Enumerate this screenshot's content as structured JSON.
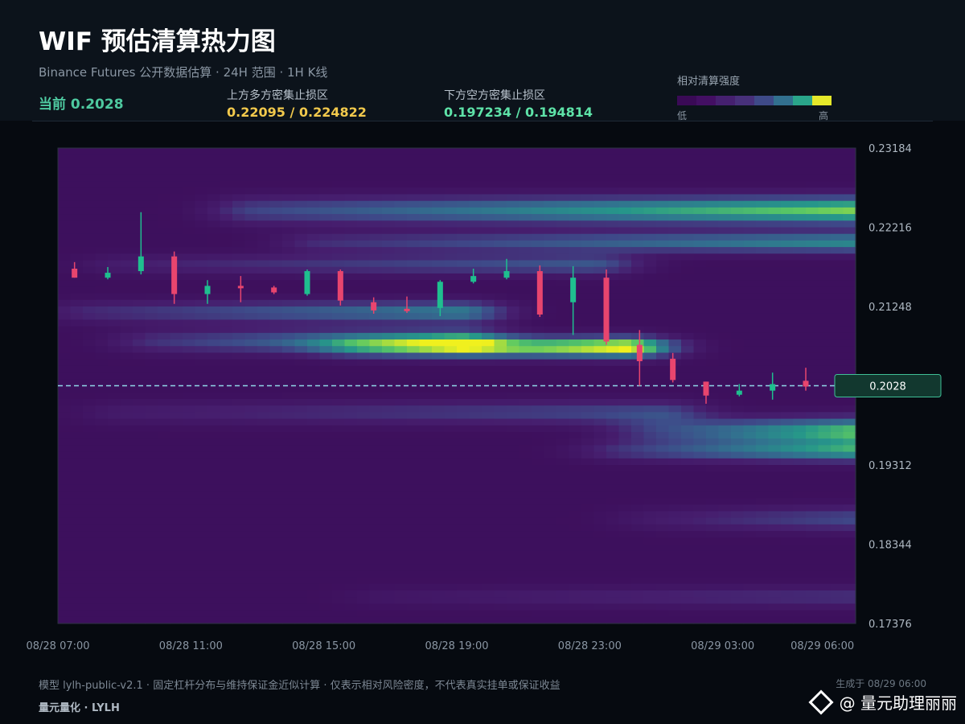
{
  "header": {
    "title": "WIF 预估清算热力图",
    "subtitle": "Binance Futures 公开数据估算 · 24H 范围 · 1H K线",
    "current_label": "当前 0.2028",
    "upper_zone": {
      "label": "上方多方密集止损区",
      "value": "0.22095 / 0.224822",
      "color": "#f2c94c"
    },
    "lower_zone": {
      "label": "下方空方密集止损区",
      "value": "0.197234 / 0.194814",
      "color": "#5ee3a8"
    }
  },
  "legend": {
    "title": "相对清算强度",
    "low": "低",
    "high": "高",
    "colors": [
      "#3a0a56",
      "#430f63",
      "#45206f",
      "#47307a",
      "#3e4a88",
      "#32708f",
      "#2aa58a",
      "#e5e82a"
    ]
  },
  "footer": {
    "note": "模型 lylh-public-v2.1 · 固定杠杆分布与维持保证金近似计算 · 仅表示相对风险密度，不代表真实挂单或保证收益",
    "brand": "量元量化 · LYLH",
    "generated": "生成于 08/29 06:00",
    "watermark": "@ 量元助理丽丽"
  },
  "chart_data": {
    "type": "heatmap",
    "title": "",
    "xlabel": "",
    "ylabel": "",
    "ylim": [
      0.17376,
      0.23184
    ],
    "y_ticks": [
      "0.23184",
      "0.22216",
      "0.21248",
      "0.2028",
      "0.19312",
      "0.18344",
      "0.17376"
    ],
    "x_ticks": [
      {
        "label": "08/28 07:00",
        "hour": 0
      },
      {
        "label": "08/28 11:00",
        "hour": 4
      },
      {
        "label": "08/28 15:00",
        "hour": 8
      },
      {
        "label": "08/28 19:00",
        "hour": 12
      },
      {
        "label": "08/28 23:00",
        "hour": 16
      },
      {
        "label": "08/29 03:00",
        "hour": 20
      },
      {
        "label": "08/29 06:00",
        "hour": 23
      }
    ],
    "current_price": 0.2028,
    "current_price_label": "0.2028",
    "bands": [
      {
        "price": 0.2242,
        "intensity": 0.8,
        "from": 6,
        "to": 24,
        "width": 0.0016
      },
      {
        "price": 0.2203,
        "intensity": 0.55,
        "from": 8,
        "to": 24,
        "width": 0.0012
      },
      {
        "price": 0.2176,
        "intensity": 0.35,
        "from": 2,
        "to": 16,
        "width": 0.0012
      },
      {
        "price": 0.2118,
        "intensity": 0.5,
        "from": 1,
        "to": 12,
        "width": 0.0013
      },
      {
        "price": 0.2075,
        "intensity": 1.0,
        "from": 9,
        "to": 17,
        "width": 0.0012
      },
      {
        "price": 0.2082,
        "intensity": 0.6,
        "from": 3,
        "to": 12,
        "width": 0.0014
      },
      {
        "price": 0.1972,
        "intensity": 0.75,
        "from": 18,
        "to": 24,
        "width": 0.0016
      },
      {
        "price": 0.1948,
        "intensity": 0.6,
        "from": 17,
        "to": 24,
        "width": 0.0012
      },
      {
        "price": 0.1995,
        "intensity": 0.3,
        "from": 2,
        "to": 18,
        "width": 0.0014
      },
      {
        "price": 0.1865,
        "intensity": 0.3,
        "from": 18,
        "to": 24,
        "width": 0.0014
      },
      {
        "price": 0.177,
        "intensity": 0.2,
        "from": 10,
        "to": 24,
        "width": 0.0012
      }
    ],
    "candles": [
      {
        "hour": 0.5,
        "open": 0.2171,
        "high": 0.2179,
        "low": 0.216,
        "close": 0.216
      },
      {
        "hour": 1.5,
        "open": 0.216,
        "high": 0.2173,
        "low": 0.2158,
        "close": 0.2166
      },
      {
        "hour": 2.5,
        "open": 0.2168,
        "high": 0.224,
        "low": 0.2164,
        "close": 0.2186
      },
      {
        "hour": 3.5,
        "open": 0.2186,
        "high": 0.2192,
        "low": 0.2128,
        "close": 0.214
      },
      {
        "hour": 4.5,
        "open": 0.214,
        "high": 0.2157,
        "low": 0.2128,
        "close": 0.215
      },
      {
        "hour": 5.5,
        "open": 0.215,
        "high": 0.2162,
        "low": 0.213,
        "close": 0.2149
      },
      {
        "hour": 6.5,
        "open": 0.2148,
        "high": 0.215,
        "low": 0.214,
        "close": 0.2142
      },
      {
        "hour": 7.5,
        "open": 0.214,
        "high": 0.217,
        "low": 0.2138,
        "close": 0.2168
      },
      {
        "hour": 8.5,
        "open": 0.2168,
        "high": 0.217,
        "low": 0.2126,
        "close": 0.2132
      },
      {
        "hour": 9.5,
        "open": 0.213,
        "high": 0.2136,
        "low": 0.2116,
        "close": 0.212
      },
      {
        "hour": 10.5,
        "open": 0.2122,
        "high": 0.2137,
        "low": 0.2117,
        "close": 0.212
      },
      {
        "hour": 11.5,
        "open": 0.2123,
        "high": 0.2157,
        "low": 0.2113,
        "close": 0.2155
      },
      {
        "hour": 12.5,
        "open": 0.2155,
        "high": 0.2171,
        "low": 0.2153,
        "close": 0.2162
      },
      {
        "hour": 13.5,
        "open": 0.216,
        "high": 0.2183,
        "low": 0.2158,
        "close": 0.2168
      },
      {
        "hour": 14.5,
        "open": 0.2168,
        "high": 0.2175,
        "low": 0.2112,
        "close": 0.2115
      },
      {
        "hour": 15.5,
        "open": 0.213,
        "high": 0.2174,
        "low": 0.209,
        "close": 0.216
      },
      {
        "hour": 16.5,
        "open": 0.216,
        "high": 0.217,
        "low": 0.2078,
        "close": 0.2082
      },
      {
        "hour": 17.5,
        "open": 0.2078,
        "high": 0.2096,
        "low": 0.2028,
        "close": 0.2058
      },
      {
        "hour": 18.5,
        "open": 0.2061,
        "high": 0.2068,
        "low": 0.2032,
        "close": 0.2035
      },
      {
        "hour": 19.5,
        "open": 0.2033,
        "high": 0.2033,
        "low": 0.2006,
        "close": 0.2016
      },
      {
        "hour": 20.5,
        "open": 0.2017,
        "high": 0.203,
        "low": 0.2015,
        "close": 0.2022
      },
      {
        "hour": 21.5,
        "open": 0.2022,
        "high": 0.2044,
        "low": 0.2011,
        "close": 0.203
      },
      {
        "hour": 22.5,
        "open": 0.2034,
        "high": 0.205,
        "low": 0.2022,
        "close": 0.2027
      }
    ],
    "up_color": "#1fbf8f",
    "down_color": "#e8456e"
  }
}
